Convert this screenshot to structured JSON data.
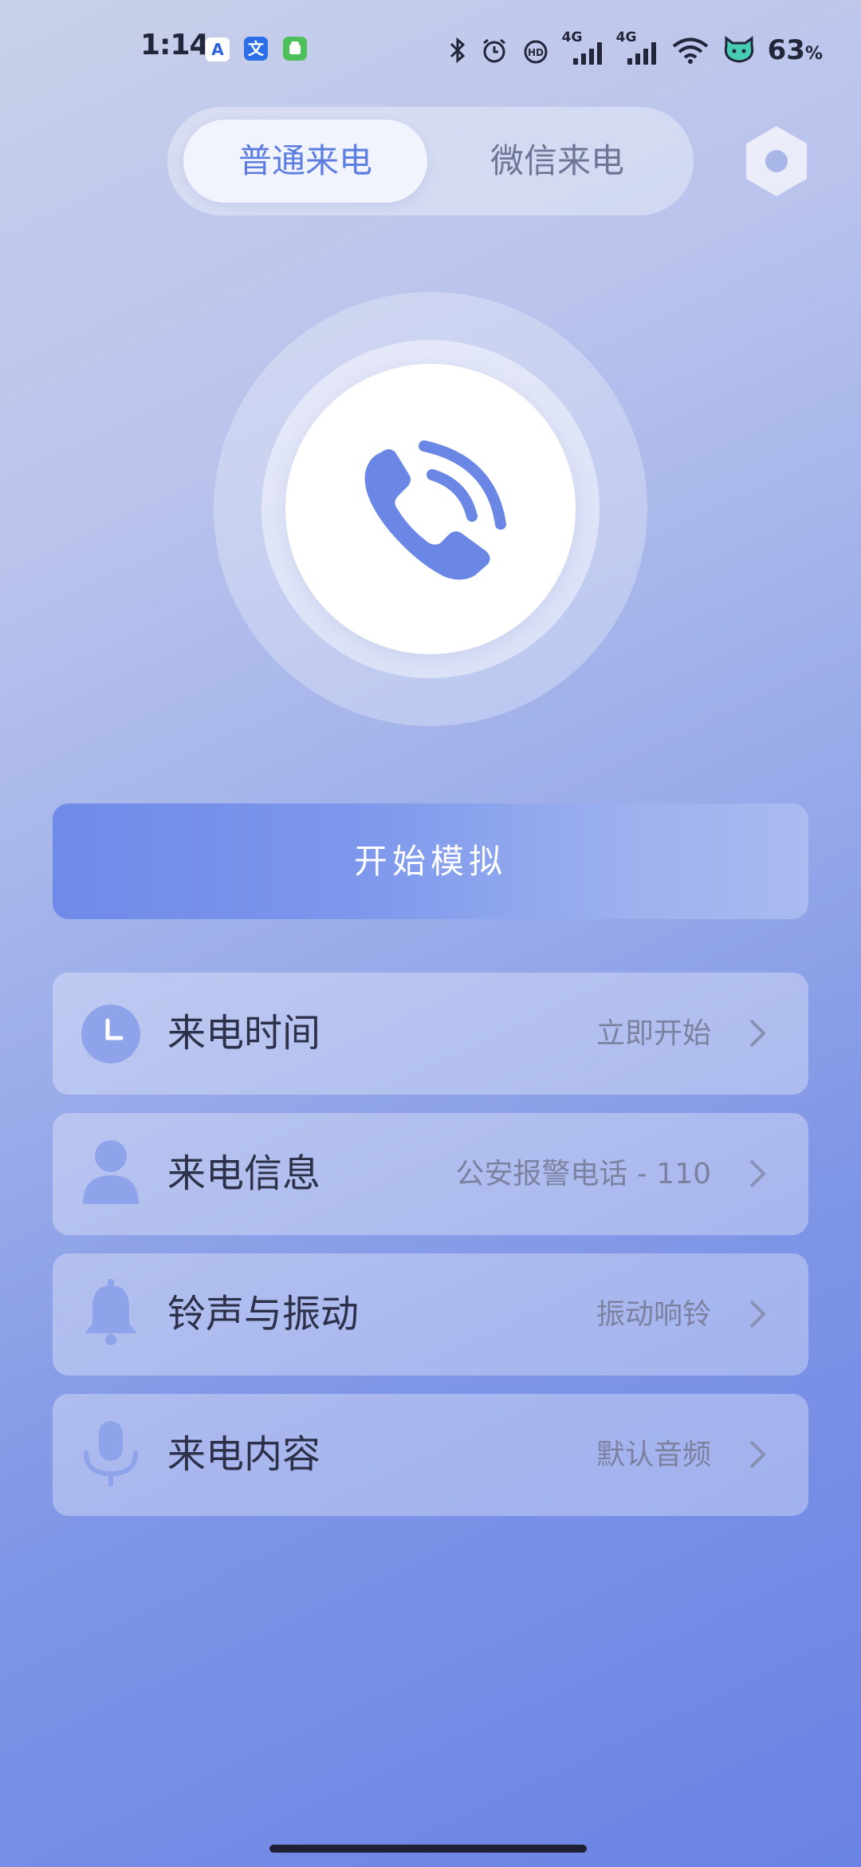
{
  "status_bar": {
    "time": "1:14",
    "battery_percent": "63",
    "battery_unit": "%",
    "net_label_1": "4G",
    "net_label_2": "4G",
    "icons": [
      "app-a-icon",
      "translate-icon",
      "android-icon",
      "bluetooth-icon",
      "alarm-icon",
      "hd-icon",
      "signal-icon",
      "signal-icon",
      "wifi-icon",
      "battery-cat-icon"
    ]
  },
  "tabs": [
    {
      "label": "普通来电",
      "active": true
    },
    {
      "label": "微信来电",
      "active": false
    }
  ],
  "call_button": {
    "icon": "phone-icon"
  },
  "start_button": {
    "label": "开始模拟"
  },
  "settings_rows": [
    {
      "icon": "clock-icon",
      "label": "来电时间",
      "value": "立即开始"
    },
    {
      "icon": "person-icon",
      "label": "来电信息",
      "value": "公安报警电话 - 110"
    },
    {
      "icon": "bell-icon",
      "label": "铃声与振动",
      "value": "振动响铃"
    },
    {
      "icon": "microphone-icon",
      "label": "来电内容",
      "value": "默认音频"
    }
  ],
  "colors": {
    "accent": "#6b87e6",
    "icon_fill": "#8fa3ea",
    "tab_active_text": "#5d7ee0"
  }
}
